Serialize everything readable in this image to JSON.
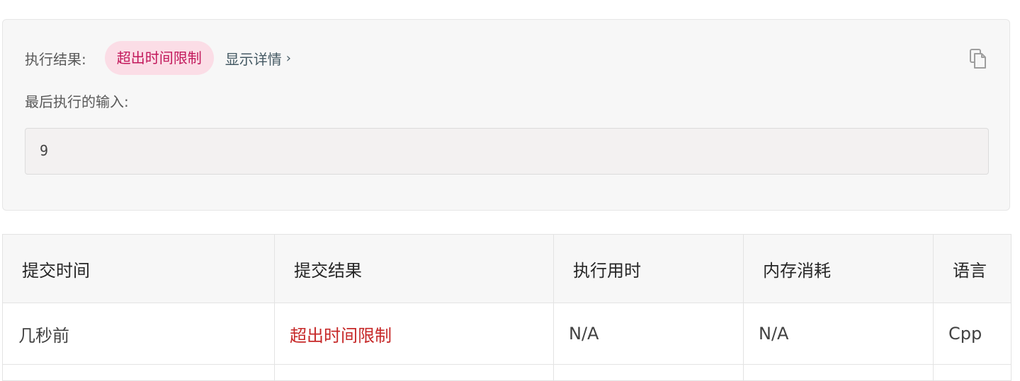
{
  "result": {
    "label": "执行结果:",
    "status": "超出时间限制",
    "details_link": "显示详情",
    "details_chevron": "›",
    "last_input_label": "最后执行的输入:",
    "last_input_value": "9",
    "copy_icon": "copy-icon"
  },
  "table": {
    "headers": [
      "提交时间",
      "提交结果",
      "执行用时",
      "内存消耗",
      "语言"
    ],
    "rows": [
      {
        "time": "几秒前",
        "status": "超出时间限制",
        "runtime": "N/A",
        "memory": "N/A",
        "language": "Cpp"
      }
    ]
  },
  "colors": {
    "status_badge_bg": "#fbdde6",
    "status_badge_text": "#c2185b",
    "status_cell_text": "#c62828"
  }
}
